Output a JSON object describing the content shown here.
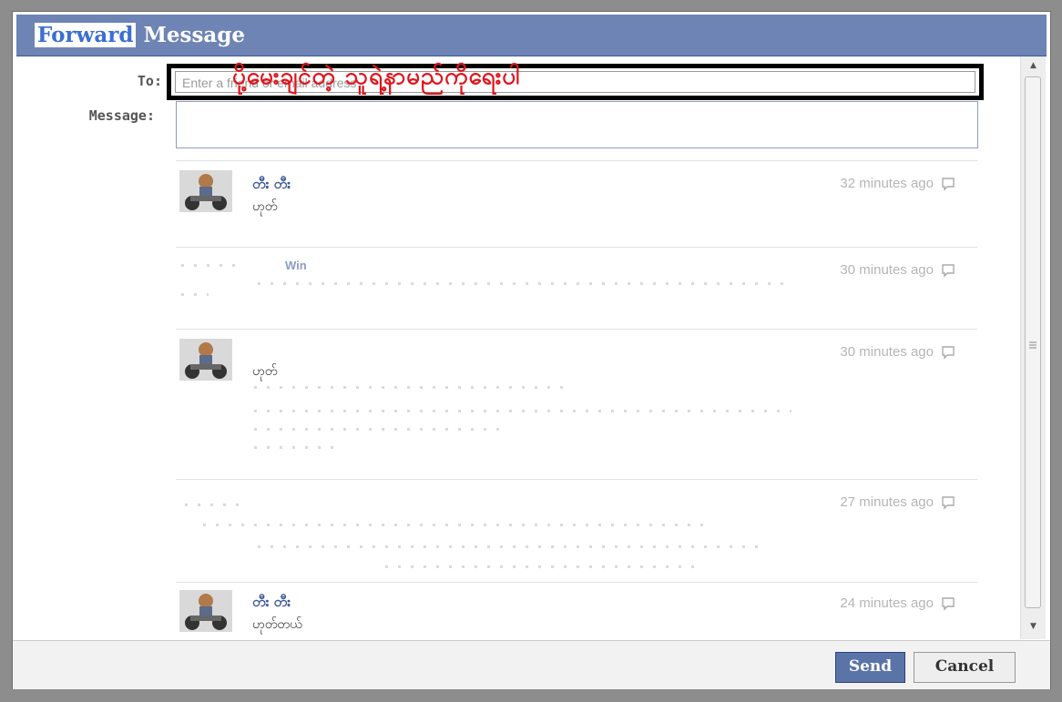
{
  "dialog": {
    "title_highlight": "Forward",
    "title_rest": " Message",
    "to_label": "To:",
    "message_label": "Message:",
    "to_placeholder": "Enter a friend or email address",
    "annotation": "ပို့မေးချင်တဲ့ သူရဲ့နာမည်ကိုရေးပါ"
  },
  "thread": [
    {
      "sender": "တီး တီး",
      "text": "ဟုတ်",
      "time": "32 minutes ago"
    },
    {
      "sender": "Win",
      "text": "",
      "time": "30 minutes ago"
    },
    {
      "sender": "",
      "text": "ဟုတ်",
      "time": "30 minutes ago"
    },
    {
      "sender": "",
      "text": "",
      "time": "27 minutes ago"
    },
    {
      "sender": "တီး တီး",
      "text": "ဟုတ်တယ်",
      "time": "24 minutes ago"
    }
  ],
  "buttons": {
    "send": "Send",
    "cancel": "Cancel"
  },
  "icons": {
    "reply": "reply-icon",
    "scroll_up": "scroll-up-icon",
    "scroll_down": "scroll-down-icon"
  },
  "colors": {
    "header": "#6d84b4",
    "send_button": "#5b74a8",
    "annotation": "#e0141b",
    "link": "#3b5998"
  }
}
